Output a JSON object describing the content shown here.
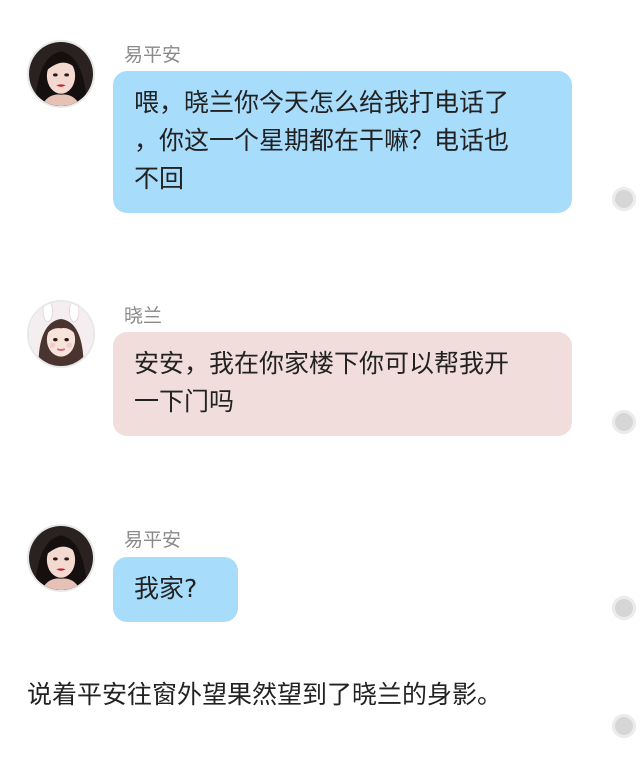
{
  "messages": [
    {
      "sender": "易平安",
      "text": "喂，晓兰你今天怎么给我打电话了\n，你这一个星期都在干嘛？电话也\n不回",
      "avatar": "girl-red-lips-avatar",
      "bubble_color": "#a8dcfb"
    },
    {
      "sender": "晓兰",
      "text": "安安，我在你家楼下你可以帮我开\n一下门吗",
      "avatar": "girl-bunny-ears-avatar",
      "bubble_color": "#f2dddd"
    },
    {
      "sender": "易平安",
      "text": "我家?",
      "avatar": "girl-red-lips-avatar",
      "bubble_color": "#a8dcfb"
    }
  ],
  "narration": "说着平安往窗外望果然望到了晓兰的身影。",
  "colors": {
    "blue_bubble": "#a8dcfb",
    "pink_bubble": "#f2dddd",
    "dot": "#d6d6d6"
  }
}
